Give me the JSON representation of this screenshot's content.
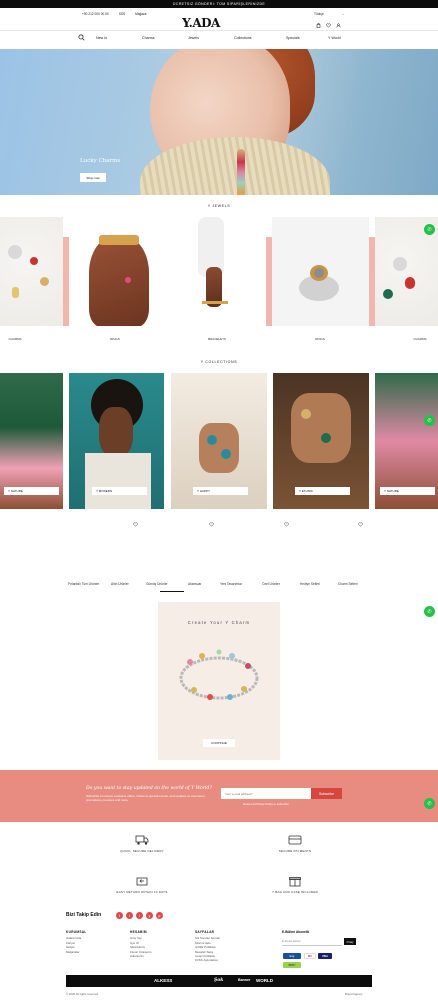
{
  "topbar": {
    "text": "ÜCRETSIZ GÖNDERI: TÜM SİPARİŞLERİNİZDE"
  },
  "infobar": {
    "phone": "+90 212 000 00 00",
    "sss": "SSS",
    "store": "Mağaza",
    "language": "Türkçe"
  },
  "logo": "Y.ADA",
  "nav": {
    "items": [
      "New In",
      "Charms",
      "Jewels",
      "Collections",
      "Specials",
      "Y World"
    ]
  },
  "hero": {
    "title": "Lucky Charms",
    "button": "Shop now"
  },
  "jewels": {
    "title": "Y JEWELS",
    "labels": [
      "CHARMS",
      "RINGS",
      "BRACELETS",
      "RINGS",
      "CHARMS"
    ]
  },
  "collections": {
    "title": "Y COLLECTIONS",
    "buttons": [
      "Y NATURE",
      "Y MODERN",
      "Y HAPPY",
      "Y ETHNIC",
      "Y NATURE"
    ]
  },
  "tabs": [
    "Pırlantalı Tüm Ürünler",
    "Altın Ürünler",
    "Gümüş Ürünler",
    "Aksesuar",
    "Yeni Tasarımlar",
    "Özel Ürünler",
    "Hediye Setleri",
    "Charm Setleri"
  ],
  "charm_promo": {
    "title": "Create Your Y Charm",
    "button": "CONTINUE"
  },
  "newsletter": {
    "headline": "Do you want to stay updated on the world of Y World?",
    "sub": "Subscribe to receive exclusive offers, invites to special events, and updates on new items, promotions, previews and more",
    "placeholder": "Your e-mail address*",
    "button": "Subscribe",
    "privacy": "Read our Privacy Policy to subscribe"
  },
  "features": [
    "QUICK, SECURE DELIVERY",
    "SECURE PAYMENTS",
    "EASY RETURN WITHIN 14 DAYS",
    "Y BAG AND CASE INCLUDED"
  ],
  "follow": "Bizi Takip Edin",
  "social": [
    "f",
    "t",
    "i",
    "y",
    "p"
  ],
  "footer": {
    "kurumsal": {
      "title": "KURUMSAL",
      "items": [
        "Hakkımızda",
        "Kariyer",
        "İletişim",
        "Mağazalar"
      ]
    },
    "hesabim": {
      "title": "HESABIM",
      "items": [
        "Giriş Yap",
        "Üye Ol",
        "Siparişlerim",
        "Favori Ürünlerim",
        "Adreslerim"
      ]
    },
    "sayfalar": {
      "title": "SAYFALAR",
      "items": [
        "Sık Sorulan Sorular",
        "İptal ve İade",
        "Gizlilik Politikası",
        "Mesafeli Satış",
        "Çerez Politikası",
        "KVKK Aydınlatma"
      ]
    },
    "ebulten": {
      "title": "E-Bülten Abonelik",
      "placeholder": "E-Posta Adresi",
      "button": "Onay"
    },
    "payments": [
      "troy",
      "MC",
      "VISA",
      "PAYU"
    ]
  },
  "brands": [
    "ALKESS",
    "Şok",
    "Banner",
    "WORLD"
  ],
  "copyright": "© 2025 All rights reserved.",
  "credit": "Brand Agency",
  "colors": {
    "newsletter": "#e88b80",
    "accent_red": "#d7473f",
    "whatsapp": "#27c04a",
    "pink_strip": "#f1b7ae"
  }
}
